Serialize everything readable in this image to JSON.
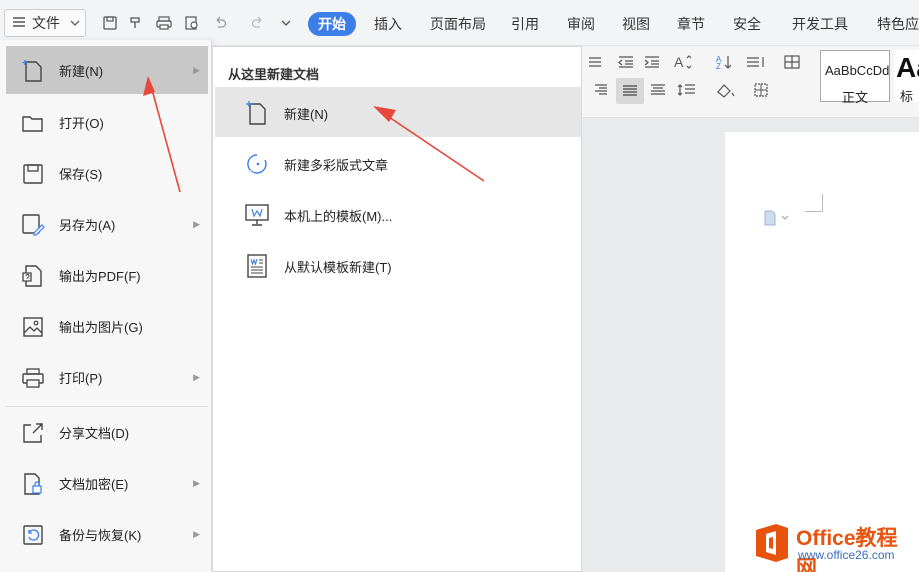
{
  "toolbar": {
    "file_label": "文件",
    "tabs": [
      "开始",
      "插入",
      "页面布局",
      "引用",
      "审阅",
      "视图",
      "章节",
      "安全",
      "开发工具",
      "特色应"
    ]
  },
  "ribbon": {
    "style_normal_sample": "AaBbCcDd",
    "style_normal_name": "正文",
    "style_h1_sample": "Aa",
    "style_h1_name": "标"
  },
  "file_menu": {
    "items": [
      {
        "label": "新建(N)",
        "icon": "new-doc-icon",
        "has_submenu": true
      },
      {
        "label": "打开(O)",
        "icon": "folder-icon",
        "has_submenu": false
      },
      {
        "label": "保存(S)",
        "icon": "save-icon",
        "has_submenu": false
      },
      {
        "label": "另存为(A)",
        "icon": "save-as-icon",
        "has_submenu": true
      },
      {
        "label": "输出为PDF(F)",
        "icon": "pdf-icon",
        "has_submenu": false
      },
      {
        "label": "输出为图片(G)",
        "icon": "image-icon",
        "has_submenu": false
      },
      {
        "label": "打印(P)",
        "icon": "print-icon",
        "has_submenu": true
      },
      {
        "label": "分享文档(D)",
        "icon": "share-icon",
        "has_submenu": false
      },
      {
        "label": "文档加密(E)",
        "icon": "lock-doc-icon",
        "has_submenu": true
      },
      {
        "label": "备份与恢复(K)",
        "icon": "backup-icon",
        "has_submenu": true
      }
    ]
  },
  "submenu": {
    "title": "从这里新建文档",
    "items": [
      {
        "label": "新建(N)",
        "icon": "new-doc-icon"
      },
      {
        "label": "新建多彩版式文章",
        "icon": "colorful-article-icon"
      },
      {
        "label": "本机上的模板(M)...",
        "icon": "local-template-icon"
      },
      {
        "label": "从默认模板新建(T)",
        "icon": "default-template-icon"
      }
    ]
  },
  "watermark": {
    "title": "Office教程网",
    "url": "www.office26.com"
  },
  "colors": {
    "accent": "#3b7ee8",
    "menu_active": "#c8c8c8",
    "annotation_arrow": "#e8473c",
    "watermark_orange": "#e8530e"
  }
}
